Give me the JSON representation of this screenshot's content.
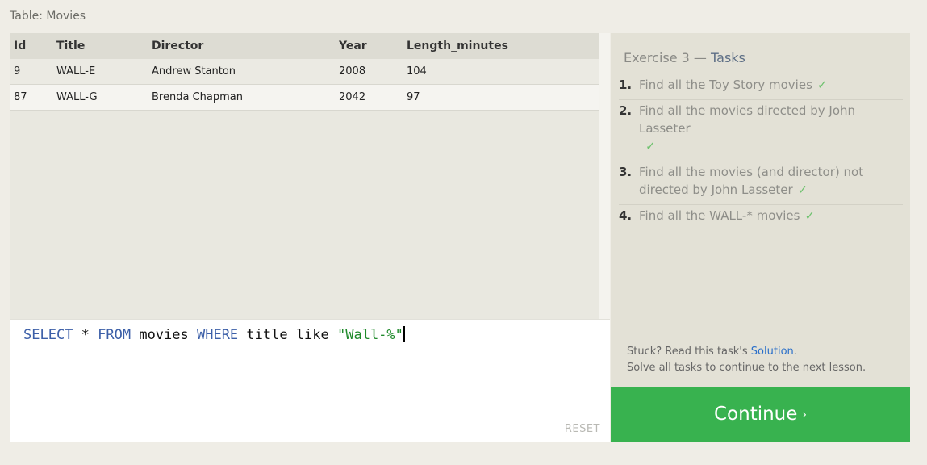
{
  "table_caption": "Table: Movies",
  "results": {
    "columns": [
      "Id",
      "Title",
      "Director",
      "Year",
      "Length_minutes"
    ],
    "rows": [
      [
        "9",
        "WALL-E",
        "Andrew Stanton",
        "2008",
        "104"
      ],
      [
        "87",
        "WALL-G",
        "Brenda Chapman",
        "2042",
        "97"
      ]
    ]
  },
  "editor": {
    "query_parts": {
      "select": "SELECT",
      "star": " * ",
      "from": "FROM",
      "table": " movies ",
      "where": "WHERE",
      "rest": " title like ",
      "literal": "\"Wall-%\""
    },
    "reset_label": "RESET"
  },
  "exercise": {
    "prefix": "Exercise 3 — ",
    "tasks_word": "Tasks",
    "tasks": [
      {
        "num": "1.",
        "text": "Find all the Toy Story movies",
        "check": "✓"
      },
      {
        "num": "2.",
        "text": "Find all the movies directed by John Lasseter",
        "check": "✓"
      },
      {
        "num": "3.",
        "text": "Find all the movies (and director) not directed by John Lasseter",
        "check": "✓"
      },
      {
        "num": "4.",
        "text": "Find all the WALL-* movies",
        "check": "✓"
      }
    ],
    "stuck_prefix": "Stuck? Read this task's ",
    "solution_label": "Solution",
    "stuck_suffix": ".",
    "solve_all": "Solve all tasks to continue to the next lesson."
  },
  "continue": {
    "label": "Continue",
    "chevron": "›"
  },
  "colors": {
    "continue_bg": "#38b24f",
    "keyword": "#3c5fa8",
    "string": "#1f8a2b",
    "check": "#6fc26f",
    "link": "#2a6fc9"
  }
}
